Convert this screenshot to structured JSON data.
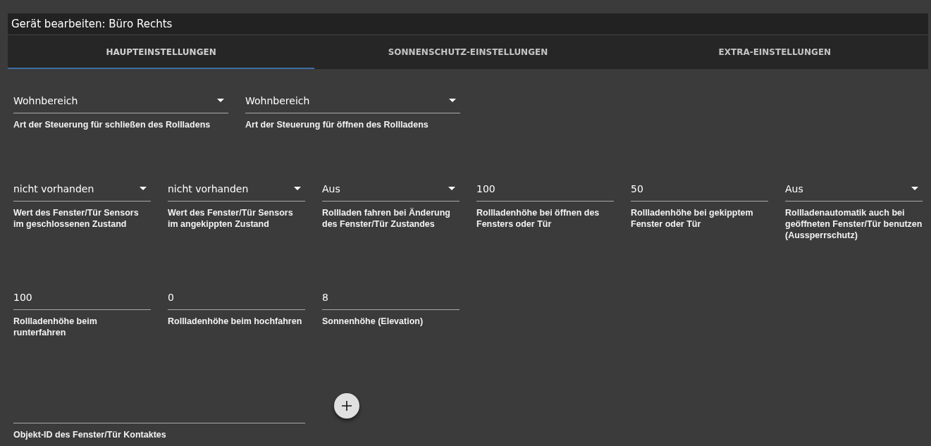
{
  "dialog": {
    "title": "Gerät bearbeiten: Büro Rechts"
  },
  "tabs": [
    {
      "label": "HAUPTEINSTELLUNGEN",
      "selected": true
    },
    {
      "label": "SONNENSCHUTZ-EINSTELLUNGEN",
      "selected": false
    },
    {
      "label": "EXTRA-EINSTELLUNGEN",
      "selected": false
    }
  ],
  "rows": [
    {
      "fields": [
        {
          "kind": "select",
          "value": "Wohnbereich",
          "helper": "Art der Steuerung für schließen des Rollladens"
        },
        {
          "kind": "select",
          "value": "Wohnbereich",
          "helper": "Art der Steuerung für öffnen des Rollladens"
        }
      ]
    },
    {
      "fields": [
        {
          "kind": "select",
          "value": "nicht vorhanden",
          "helper": "Wert des Fenster/Tür Sensors im geschlossenen Zustand"
        },
        {
          "kind": "select",
          "value": "nicht vorhanden",
          "helper": "Wert des Fenster/Tür Sensors im angekippten Zustand"
        },
        {
          "kind": "select",
          "value": "Aus",
          "helper": "Rollladen fahren bei Änderung des Fenster/Tür Zustandes"
        },
        {
          "kind": "text",
          "value": "100",
          "helper": "Rollladenhöhe bei öffnen des Fensters oder Tür"
        },
        {
          "kind": "text",
          "value": "50",
          "helper": "Rollladenhöhe bei gekipptem Fenster oder Tür"
        },
        {
          "kind": "select",
          "value": "Aus",
          "helper": "Rollladenautomatik auch bei geöffneten Fenster/Tür benutzen (Aussperrschutz)"
        }
      ]
    },
    {
      "fields": [
        {
          "kind": "text",
          "value": "100",
          "helper": "Rollladenhöhe beim runterfahren"
        },
        {
          "kind": "text",
          "value": "0",
          "helper": "Rollladenhöhe beim hochfahren"
        },
        {
          "kind": "text",
          "value": "8",
          "helper": "Sonnenhöhe (Elevation)"
        }
      ]
    }
  ],
  "object_id": {
    "helper": "Objekt-ID des Fenster/Tür Kontaktes"
  }
}
